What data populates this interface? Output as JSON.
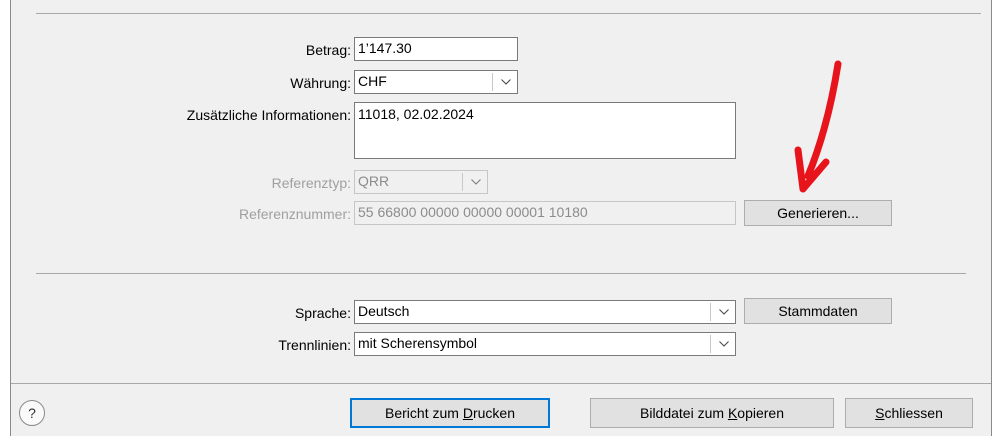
{
  "form": {
    "betrag": {
      "label": "Betrag:",
      "value": "1’147.30"
    },
    "waehrung": {
      "label": "Währung:",
      "value": "CHF"
    },
    "zusatz": {
      "label": "Zusätzliche Informationen:",
      "value": "11018, 02.02.2024"
    },
    "referenztyp": {
      "label": "Referenztyp:",
      "value": "QRR"
    },
    "referenznummer": {
      "label": "Referenznummer:",
      "value": "55 66800 00000 00000 00001 10180"
    },
    "generieren_label": "Generieren...",
    "sprache": {
      "label": "Sprache:",
      "value": "Deutsch"
    },
    "stammdaten_label": "Stammdaten",
    "trennlinien": {
      "label": "Trennlinien:",
      "value": "mit Scherensymbol"
    }
  },
  "footer": {
    "help_label": "?",
    "bericht": {
      "pre": "Bericht zum ",
      "key": "D",
      "post": "rucken"
    },
    "bilddatei": {
      "pre": "Bilddatei zum ",
      "key": "K",
      "post": "opieren"
    },
    "schliessen": {
      "pre": "",
      "key": "S",
      "post": "chliessen"
    }
  },
  "annotation": {
    "color": "#e8141c",
    "icon": "red-arrow-annotation"
  },
  "colors": {
    "dialog_bg": "#f0f0f0",
    "default_button_border": "#0078d7"
  }
}
